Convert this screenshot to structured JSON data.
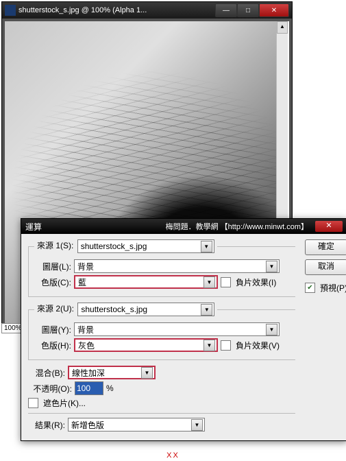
{
  "image_window": {
    "title": "shutterstock_s.jpg @ 100% (Alpha 1...",
    "zoom": "100%"
  },
  "dialog": {
    "title": "運算",
    "watermark": "梅問題．教學網 【http://www.minwt.com】",
    "source1": {
      "legend": "來源 1(S):",
      "file": "shutterstock_s.jpg",
      "layer_label": "圖層(L):",
      "layer": "背景",
      "channel_label": "色版(C):",
      "channel": "藍",
      "invert_label": "負片效果(I)"
    },
    "source2": {
      "legend": "來源 2(U):",
      "file": "shutterstock_s.jpg",
      "layer_label": "圖層(Y):",
      "layer": "背景",
      "channel_label": "色版(H):",
      "channel": "灰色",
      "invert_label": "負片效果(V)"
    },
    "blend": {
      "label": "混合(B):",
      "value": "線性加深"
    },
    "opacity": {
      "label": "不透明(O):",
      "value": "100",
      "unit": "%"
    },
    "mask_label": "遮色片(K)...",
    "result": {
      "label": "結果(R):",
      "value": "新增色版"
    },
    "buttons": {
      "ok": "確定",
      "cancel": "取消",
      "preview": "預視(P)"
    }
  },
  "footer_mark": "XX"
}
